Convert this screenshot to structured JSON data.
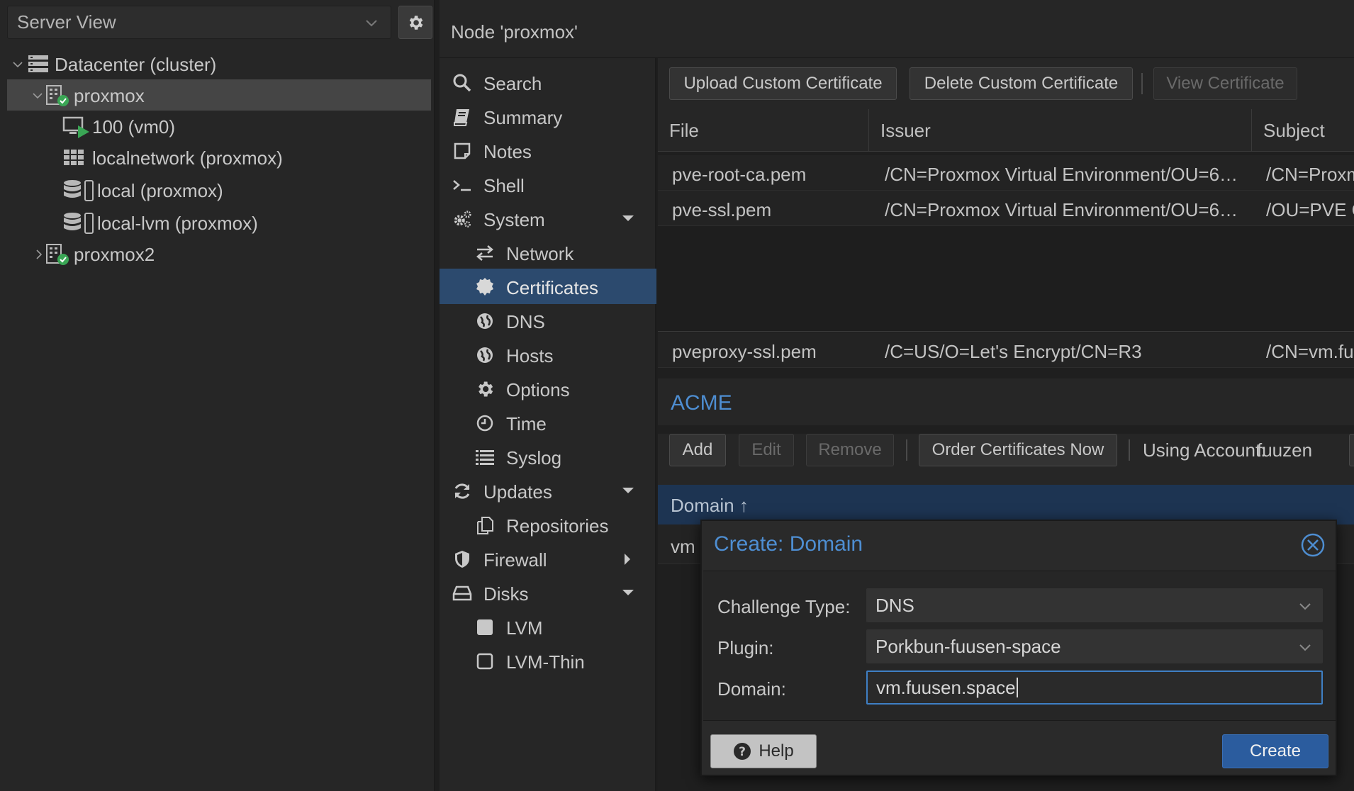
{
  "left_panel": {
    "view_select": "Server View",
    "tree": [
      {
        "label": "Datacenter (cluster)",
        "icon": "datacenter-icon",
        "level": 0,
        "expanded": true
      },
      {
        "label": "proxmox",
        "icon": "node-online-icon",
        "level": 1,
        "expanded": true,
        "selected": true
      },
      {
        "label": "100 (vm0)",
        "icon": "vm-running-icon",
        "level": 2
      },
      {
        "label": "localnetwork (proxmox)",
        "icon": "sdn-grid-icon",
        "level": 2
      },
      {
        "label": "local (proxmox)",
        "icon": "storage-icon",
        "level": 2
      },
      {
        "label": "local-lvm (proxmox)",
        "icon": "storage-icon",
        "level": 2
      },
      {
        "label": "proxmox2",
        "icon": "node-online-icon",
        "level": 1,
        "expanded": false
      }
    ]
  },
  "header": {
    "title": "Node 'proxmox'"
  },
  "nav": {
    "items": [
      {
        "label": "Search",
        "icon": "search-icon"
      },
      {
        "label": "Summary",
        "icon": "book-icon"
      },
      {
        "label": "Notes",
        "icon": "notes-icon"
      },
      {
        "label": "Shell",
        "icon": "terminal-icon"
      },
      {
        "label": "System",
        "icon": "gears-icon"
      },
      {
        "label": "Network",
        "icon": "exchange-icon"
      },
      {
        "label": "Certificates",
        "icon": "certificate-icon"
      },
      {
        "label": "DNS",
        "icon": "globe-icon"
      },
      {
        "label": "Hosts",
        "icon": "globe-icon"
      },
      {
        "label": "Options",
        "icon": "gear-icon"
      },
      {
        "label": "Time",
        "icon": "clock-icon"
      },
      {
        "label": "Syslog",
        "icon": "list-icon"
      },
      {
        "label": "Updates",
        "icon": "refresh-icon"
      },
      {
        "label": "Repositories",
        "icon": "files-icon"
      },
      {
        "label": "Firewall",
        "icon": "shield-icon"
      },
      {
        "label": "Disks",
        "icon": "hdd-icon"
      },
      {
        "label": "LVM",
        "icon": "square-icon"
      },
      {
        "label": "LVM-Thin",
        "icon": "square-outline-icon"
      }
    ]
  },
  "certificates": {
    "toolbar": {
      "upload": "Upload Custom Certificate",
      "delete": "Delete Custom Certificate",
      "view": "View Certificate"
    },
    "columns": [
      "File",
      "Issuer",
      "Subject"
    ],
    "rows": [
      {
        "file": "pve-root-ca.pem",
        "issuer": "/CN=Proxmox Virtual Environment/OU=6…",
        "subject": "/CN=Proxm"
      },
      {
        "file": "pve-ssl.pem",
        "issuer": "/CN=Proxmox Virtual Environment/OU=6…",
        "subject": "/OU=PVE C"
      },
      {
        "file": "pveproxy-ssl.pem",
        "issuer": "/C=US/O=Let's Encrypt/CN=R3",
        "subject": "/CN=vm.fu"
      }
    ]
  },
  "acme": {
    "title": "ACME",
    "toolbar": {
      "add": "Add",
      "edit": "Edit",
      "remove": "Remove",
      "order": "Order Certificates Now",
      "account_label": "Using Account:",
      "account_value": "fuuzen"
    },
    "domain_header": "Domain ↑",
    "domain_row": "vm"
  },
  "modal": {
    "title": "Create: Domain",
    "challenge_label": "Challenge Type:",
    "challenge_value": "DNS",
    "plugin_label": "Plugin:",
    "plugin_value": "Porkbun-fuusen-space",
    "domain_label": "Domain:",
    "domain_value": "vm.fuusen.space",
    "help": "Help",
    "create": "Create"
  },
  "colors": {
    "accent": "#4e8ed2",
    "selected_nav": "#2c4a6e",
    "primary_button": "#2b5c9e",
    "online": "#3aa655"
  }
}
